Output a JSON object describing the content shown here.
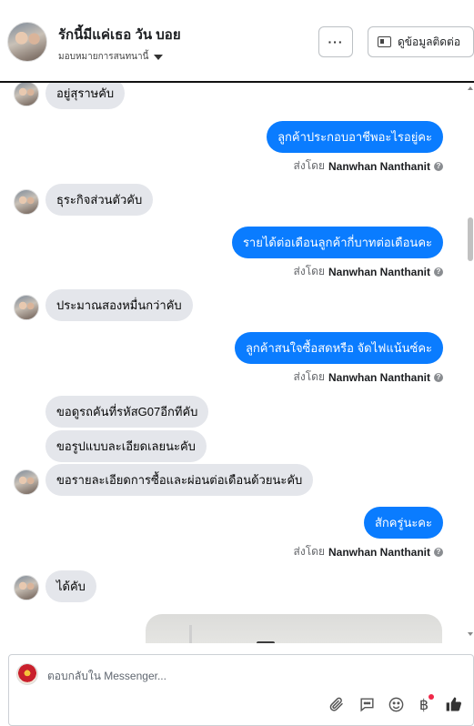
{
  "header": {
    "contact_name": "รักนี้มีแค่เธอ วัน บอย",
    "assign_label": "มอบหมายการสนทนานี้",
    "more_label": "···",
    "contact_info_label": "ดูข้อมูลติดต่อ"
  },
  "messages": [
    {
      "type": "incoming",
      "text": "อยู่สุราษคับ"
    },
    {
      "type": "outgoing",
      "text": "ลูกค้าประกอบอาชีพอะไรอยู่คะ",
      "sent_by_prefix": "ส่งโดย",
      "sender": "Nanwhan Nanthanit"
    },
    {
      "type": "incoming",
      "text": "ธุระกิจส่วนตัวคับ"
    },
    {
      "type": "outgoing",
      "text": "รายได้ต่อเดือนลูกค้ากี่บาทต่อเดือนคะ",
      "sent_by_prefix": "ส่งโดย",
      "sender": "Nanwhan Nanthanit"
    },
    {
      "type": "incoming",
      "text": "ประมาณสองหมื่นกว่าคับ"
    },
    {
      "type": "outgoing",
      "text": "ลูกค้าสนใจซื้อสดหรือ จัดไฟแน้นซ์คะ",
      "sent_by_prefix": "ส่งโดย",
      "sender": "Nanwhan Nanthanit"
    },
    {
      "type": "incoming",
      "text": "ขอดูรถคันที่รหัสG07อีกทีคับ"
    },
    {
      "type": "incoming",
      "text": "ขอรูปแบบละเอียดเลยนะคับ"
    },
    {
      "type": "incoming",
      "text": "ขอรายละเอียดการซื้อและผ่อนต่อเดือนด้วยนะคับ"
    },
    {
      "type": "outgoing",
      "text": "สักครู่นะคะ",
      "sent_by_prefix": "ส่งโดย",
      "sender": "Nanwhan Nanthanit"
    },
    {
      "type": "incoming",
      "text": "ได้คับ"
    }
  ],
  "composer": {
    "placeholder": "ตอบกลับใน Messenger...",
    "icons": [
      "paperclip-icon",
      "saved-reply-icon",
      "emoji-icon",
      "baht-icon",
      "thumbs-up-icon"
    ],
    "baht_symbol": "฿"
  },
  "colors": {
    "outgoing_bubble": "#0a7cff",
    "incoming_bubble": "#e4e6eb",
    "notification_dot": "#f02849"
  }
}
